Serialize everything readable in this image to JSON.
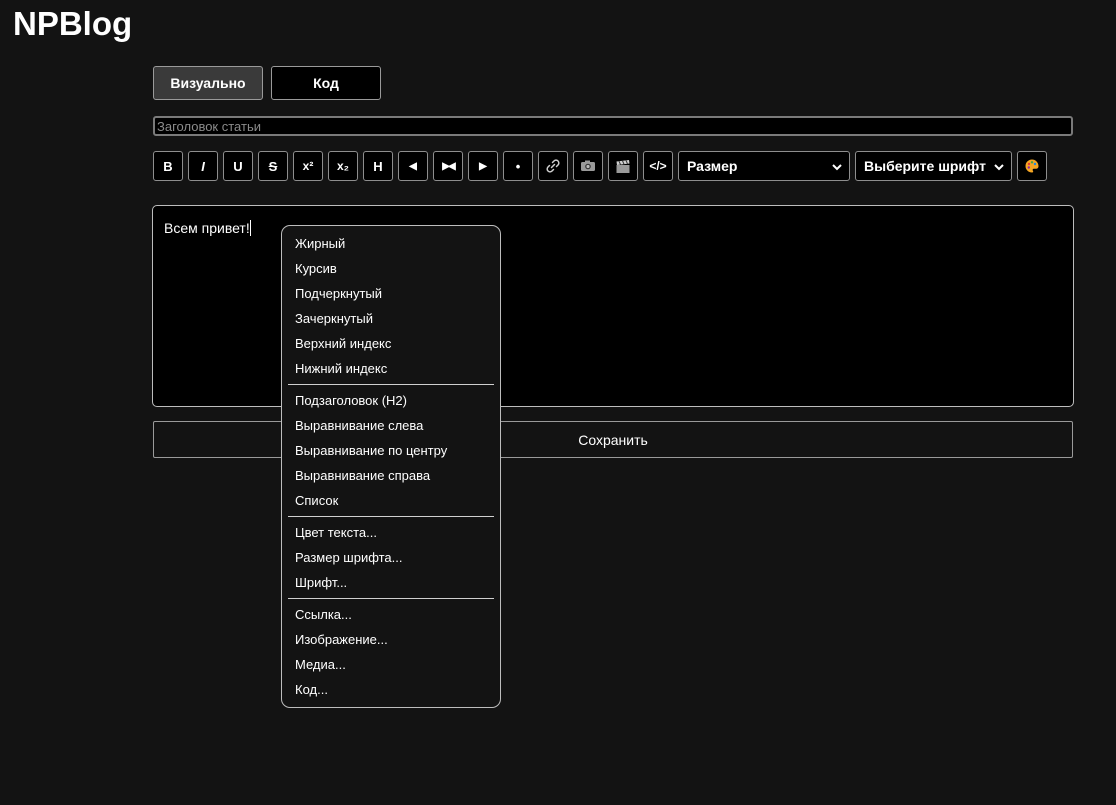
{
  "brand": "NPBlog",
  "mode_tabs": {
    "visual": "Визуально",
    "code": "Код"
  },
  "title_field": {
    "placeholder": "Заголовок статьи",
    "value": ""
  },
  "toolbar": {
    "bold": "B",
    "italic": "I",
    "underline": "U",
    "strike": "S",
    "superscript": "x²",
    "subscript": "x₂",
    "heading": "H",
    "align_left": "◀",
    "align_center": "▶◀",
    "align_right": "▶",
    "list": "•",
    "code": "</>",
    "size_select": "Размер",
    "font_select": "Выберите шрифт"
  },
  "editor": {
    "content": "Всем привет!"
  },
  "save_button": "Сохранить",
  "context_menu": {
    "group1": [
      "Жирный",
      "Курсив",
      "Подчеркнутый",
      "Зачеркнутый",
      "Верхний индекс",
      "Нижний индекс"
    ],
    "group2": [
      "Подзаголовок (H2)",
      "Выравнивание слева",
      "Выравнивание по центру",
      "Выравнивание справа",
      "Список"
    ],
    "group3": [
      "Цвет текста...",
      "Размер шрифта...",
      "Шрифт..."
    ],
    "group4": [
      "Ссылка...",
      "Изображение...",
      "Медиа...",
      "Код..."
    ]
  },
  "colors": {
    "background": "#131313",
    "editor_bg": "#000000",
    "active_tab": "#3a3a3a",
    "palette_accent": "#f5a623"
  }
}
